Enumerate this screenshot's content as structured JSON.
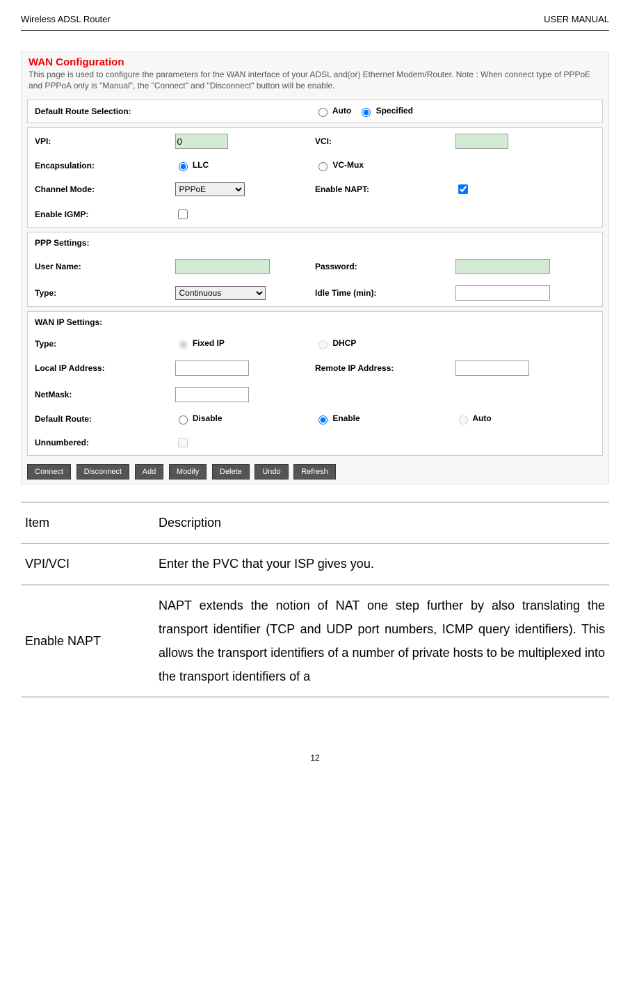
{
  "header": {
    "left": "Wireless ADSL Router",
    "right": "USER MANUAL"
  },
  "wan": {
    "title": "WAN Configuration",
    "desc": "This page is used to configure the parameters for the WAN interface of your ADSL and(or) Ethernet Modem/Router. Note : When connect type of PPPoE and PPPoA only is \"Manual\", the \"Connect\" and \"Disconnect\" button will be enable.",
    "default_route_label": "Default Route Selection:",
    "auto_label": "Auto",
    "specified_label": "Specified",
    "vpi_label": "VPI:",
    "vpi_value": "0",
    "vci_label": "VCI:",
    "encap_label": "Encapsulation:",
    "llc_label": "LLC",
    "vcmux_label": "VC-Mux",
    "channel_mode_label": "Channel Mode:",
    "channel_mode_value": "PPPoE",
    "enable_napt_label": "Enable NAPT:",
    "enable_igmp_label": "Enable IGMP:",
    "ppp_settings_label": "PPP Settings:",
    "username_label": "User Name:",
    "password_label": "Password:",
    "type_label": "Type:",
    "type_value": "Continuous",
    "idle_time_label": "Idle Time (min):",
    "wanip_label": "WAN IP Settings:",
    "fixedip_label": "Fixed IP",
    "dhcp_label": "DHCP",
    "localip_label": "Local IP Address:",
    "remoteip_label": "Remote IP Address:",
    "netmask_label": "NetMask:",
    "defroute_label": "Default Route:",
    "disable_label": "Disable",
    "enable_label": "Enable",
    "autoroute_label": "Auto",
    "unnumbered_label": "Unnumbered:"
  },
  "buttons": {
    "connect": "Connect",
    "disconnect": "Disconnect",
    "add": "Add",
    "modify": "Modify",
    "delete": "Delete",
    "undo": "Undo",
    "refresh": "Refresh"
  },
  "table": {
    "item_header": "Item",
    "desc_header": "Description",
    "vpivci_item": "VPI/VCI",
    "vpivci_desc": "Enter the PVC that your ISP gives you.",
    "napt_item": "Enable NAPT",
    "napt_desc": "NAPT extends the notion of NAT one step further by also translating the transport identifier (TCP and UDP port numbers, ICMP query identifiers). This allows the transport identifiers of a number of private hosts to be multiplexed into the transport identifiers of a"
  },
  "page_number": "12"
}
